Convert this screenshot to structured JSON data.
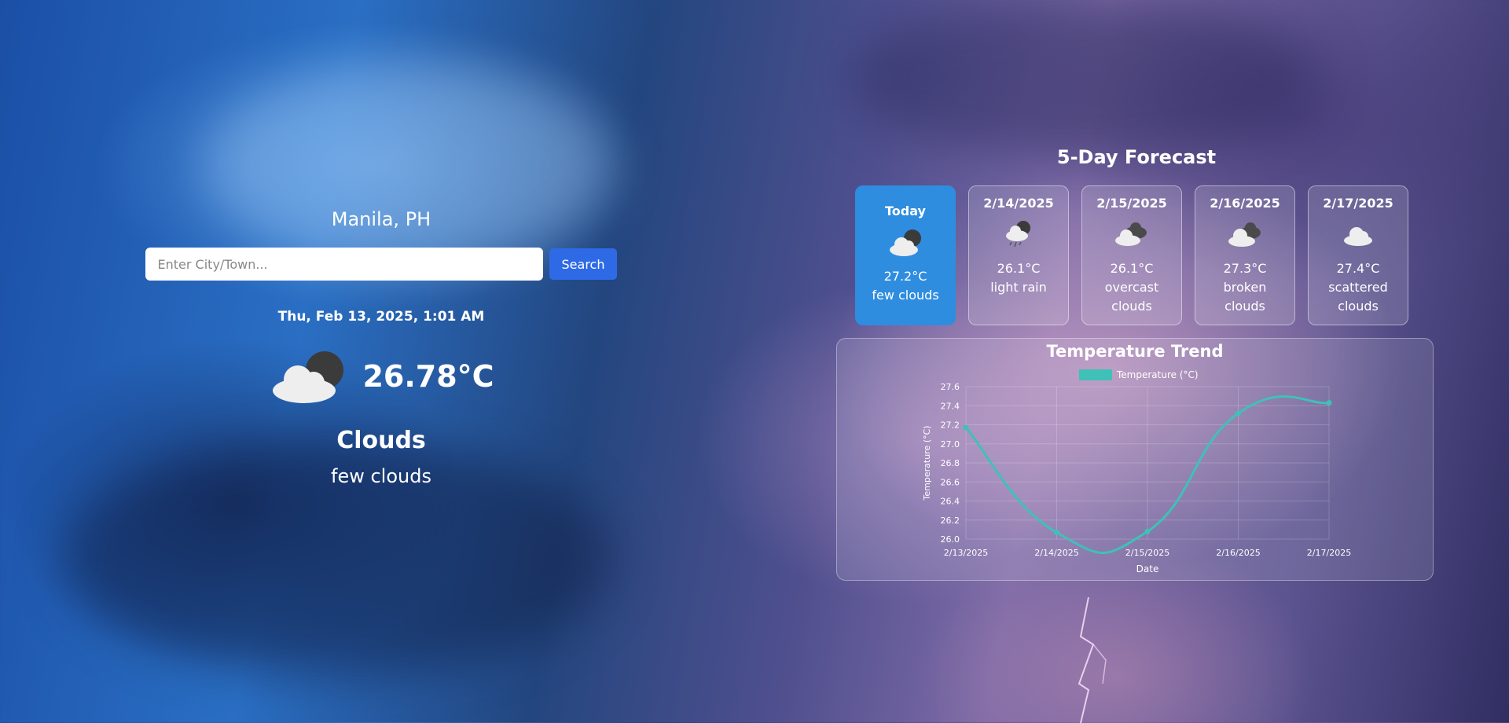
{
  "location": "Manila, PH",
  "search": {
    "placeholder": "Enter City/Town...",
    "button_label": "Search"
  },
  "current": {
    "datetime": "Thu, Feb 13, 2025, 1:01 AM",
    "icon": "few-clouds-night-icon",
    "temperature": "26.78°C",
    "condition": "Clouds",
    "description": "few clouds"
  },
  "forecast": {
    "title": "5-Day Forecast",
    "days": [
      {
        "date": "Today",
        "icon": "few-clouds-night-icon",
        "temp": "27.2°C",
        "desc_lines": [
          "few clouds"
        ]
      },
      {
        "date": "2/14/2025",
        "icon": "light-rain-icon",
        "temp": "26.1°C",
        "desc_lines": [
          "light rain"
        ]
      },
      {
        "date": "2/15/2025",
        "icon": "overcast-clouds-icon",
        "temp": "26.1°C",
        "desc_lines": [
          "overcast",
          "clouds"
        ]
      },
      {
        "date": "2/16/2025",
        "icon": "broken-clouds-icon",
        "temp": "27.3°C",
        "desc_lines": [
          "broken",
          "clouds"
        ]
      },
      {
        "date": "2/17/2025",
        "icon": "scattered-clouds-icon",
        "temp": "27.4°C",
        "desc_lines": [
          "scattered",
          "clouds"
        ]
      }
    ]
  },
  "colors": {
    "accent": "#2f8de0",
    "button": "#2f6ae6",
    "line": "#3fc1b8"
  },
  "chart_data": {
    "type": "line",
    "title": "Temperature Trend",
    "xlabel": "Date",
    "ylabel": "Temperature (°C)",
    "categories": [
      "2/13/2025",
      "2/14/2025",
      "2/15/2025",
      "2/16/2025",
      "2/17/2025"
    ],
    "series": [
      {
        "name": "Temperature (°C)",
        "values": [
          27.17,
          26.07,
          26.08,
          27.32,
          27.43
        ]
      }
    ],
    "ylim": [
      26.0,
      27.6
    ],
    "yticks": [
      "26.0",
      "26.2",
      "26.4",
      "26.6",
      "26.8",
      "27.0",
      "27.2",
      "27.4",
      "27.6"
    ],
    "grid": true,
    "legend": "top-center"
  }
}
